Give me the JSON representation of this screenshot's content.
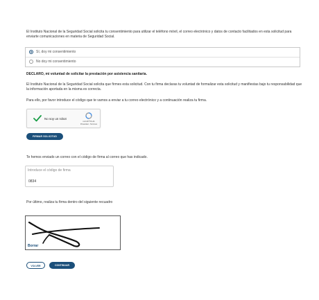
{
  "consent": {
    "intro": "El Instituto Nacional de la Seguridad Social solicita tu consentimiento para utilizar el teléfono móvil, el correo electrónico y datos de contacto facilitados en esta solicitud para enviarte comunicaciones en materia de Seguridad Social.",
    "options": [
      {
        "label": "Sí, doy mi consentimiento",
        "selected": true
      },
      {
        "label": "No doy mi consentimiento",
        "selected": false
      }
    ]
  },
  "declaration": {
    "heading": "DECLARO, mi voluntad de solicitar la prestación por asistencia sanitaria.",
    "text1": "El Instituto Nacional de la Seguridad Social solicita que firmes esta solicitud. Con tu firma declaras tu voluntad de formalizar esta solicitud y manifiestas bajo tu responsabilidad que la información aportada en la misma es correcta.",
    "text2": "Para ello, por favor introduce el código que te vamos a enviar a tu correo electrónico y a continuación realiza tu firma."
  },
  "captcha": {
    "label": "No soy un robot",
    "brand": "reCAPTCHA",
    "terms": "Privacidad - Términos",
    "colors": {
      "check": "#1a9e47",
      "logo_blue": "#4a90e2",
      "logo_grey": "#9aa0a6"
    }
  },
  "sign_request_button": "FIRMAR SOLICITUD",
  "code": {
    "email_sent": "Te hemos enviado un correo con el código de firma al correo que has indicado.",
    "label": "Introduce el código de firma",
    "value": "0834"
  },
  "signature": {
    "instruction": "Por último, realiza tu firma dentro del siguiente recuadro",
    "clear_label": "Borrar"
  },
  "nav": {
    "back_label": "VOLVER",
    "continue_label": "CONTINUAR"
  },
  "colors": {
    "primary": "#1b4f7a",
    "border": "#c8c8c8"
  }
}
